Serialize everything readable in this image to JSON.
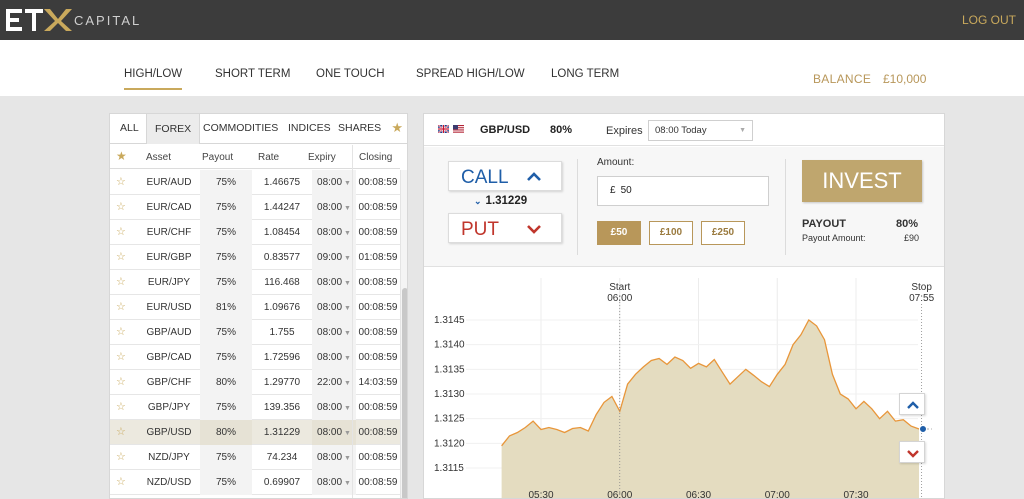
{
  "header": {
    "logo_text": "ETX",
    "logo_word": "CAPITAL",
    "logout_label": "LOG OUT"
  },
  "nav": {
    "items": [
      {
        "label": "HIGH/LOW",
        "active": true
      },
      {
        "label": "SHORT TERM",
        "active": false
      },
      {
        "label": "ONE TOUCH",
        "active": false
      },
      {
        "label": "SPREAD HIGH/LOW",
        "active": false
      },
      {
        "label": "LONG TERM",
        "active": false
      }
    ],
    "balance_label": "BALANCE",
    "balance_value": "£10,000"
  },
  "assets": {
    "filter_tabs": [
      "ALL",
      "FOREX",
      "COMMODITIES",
      "INDICES",
      "SHARES"
    ],
    "active_tab": "FOREX",
    "columns": [
      "Asset",
      "Payout",
      "Rate",
      "Expiry",
      "Closing"
    ],
    "rows": [
      {
        "asset": "EUR/AUD",
        "payout": "75%",
        "rate": "1.46675",
        "expiry": "08:00",
        "closing": "00:08:59"
      },
      {
        "asset": "EUR/CAD",
        "payout": "75%",
        "rate": "1.44247",
        "expiry": "08:00",
        "closing": "00:08:59"
      },
      {
        "asset": "EUR/CHF",
        "payout": "75%",
        "rate": "1.08454",
        "expiry": "08:00",
        "closing": "00:08:59"
      },
      {
        "asset": "EUR/GBP",
        "payout": "75%",
        "rate": "0.83577",
        "expiry": "09:00",
        "closing": "01:08:59"
      },
      {
        "asset": "EUR/JPY",
        "payout": "75%",
        "rate": "116.468",
        "expiry": "08:00",
        "closing": "00:08:59"
      },
      {
        "asset": "EUR/USD",
        "payout": "81%",
        "rate": "1.09676",
        "expiry": "08:00",
        "closing": "00:08:59"
      },
      {
        "asset": "GBP/AUD",
        "payout": "75%",
        "rate": "1.755",
        "expiry": "08:00",
        "closing": "00:08:59"
      },
      {
        "asset": "GBP/CAD",
        "payout": "75%",
        "rate": "1.72596",
        "expiry": "08:00",
        "closing": "00:08:59"
      },
      {
        "asset": "GBP/CHF",
        "payout": "80%",
        "rate": "1.29770",
        "expiry": "22:00",
        "closing": "14:03:59"
      },
      {
        "asset": "GBP/JPY",
        "payout": "75%",
        "rate": "139.356",
        "expiry": "08:00",
        "closing": "00:08:59"
      },
      {
        "asset": "GBP/USD",
        "payout": "80%",
        "rate": "1.31229",
        "expiry": "08:00",
        "closing": "00:08:59",
        "selected": true
      },
      {
        "asset": "NZD/JPY",
        "payout": "75%",
        "rate": "74.234",
        "expiry": "08:00",
        "closing": "00:08:59"
      },
      {
        "asset": "NZD/USD",
        "payout": "75%",
        "rate": "0.69907",
        "expiry": "08:00",
        "closing": "00:08:59"
      }
    ]
  },
  "trade": {
    "pair": "GBP/USD",
    "payout": "80%",
    "expires_label": "Expires",
    "expires_value": "08:00 Today",
    "call_label": "CALL",
    "put_label": "PUT",
    "current_rate": "1.31229",
    "amount_label": "Amount:",
    "currency_symbol": "£",
    "amount_value": "50",
    "quick_amounts": [
      "£50",
      "£100",
      "£250"
    ],
    "active_quick_amount": "£50",
    "invest_label": "INVEST",
    "payout_label": "PAYOUT",
    "payout_pct": "80%",
    "payout_amount_label": "Payout Amount:",
    "payout_amount_value": "£90"
  },
  "colors": {
    "accent_gold": "#c9a95c",
    "call_blue": "#1f5ea8",
    "put_red": "#c0362c",
    "chart_line": "#e8963a",
    "chart_fill": "#e4dcc0"
  },
  "chart_data": {
    "type": "area",
    "y_ticks": [
      "1.3145",
      "1.3140",
      "1.3135",
      "1.3130",
      "1.3125",
      "1.3120",
      "1.3115"
    ],
    "ylim": [
      1.3112,
      1.3148
    ],
    "x_ticks": [
      "05:30",
      "06:00",
      "06:30",
      "07:00",
      "07:30"
    ],
    "start_label": "Start",
    "start_time": "06:00",
    "stop_label": "Stop",
    "stop_time": "07:55",
    "x_minutes": [
      315,
      318,
      321,
      324,
      327,
      330,
      333,
      336,
      339,
      342,
      345,
      348,
      351,
      354,
      357,
      360,
      363,
      366,
      369,
      372,
      375,
      378,
      381,
      384,
      387,
      390,
      393,
      396,
      399,
      402,
      405,
      408,
      411,
      414,
      417,
      420,
      423,
      426,
      429,
      432,
      435,
      438,
      441,
      444,
      447,
      450,
      453,
      456,
      459,
      462,
      465,
      468,
      471,
      474
    ],
    "y_values": [
      1.31195,
      1.31215,
      1.31222,
      1.31232,
      1.31245,
      1.31228,
      1.31232,
      1.31228,
      1.31222,
      1.3123,
      1.31232,
      1.31225,
      1.31258,
      1.31283,
      1.31295,
      1.31265,
      1.3132,
      1.3134,
      1.31355,
      1.31368,
      1.31372,
      1.3136,
      1.31375,
      1.31368,
      1.31352,
      1.31362,
      1.31355,
      1.3137,
      1.31345,
      1.3132,
      1.31335,
      1.3135,
      1.31338,
      1.31325,
      1.31315,
      1.3134,
      1.3136,
      1.314,
      1.3142,
      1.3145,
      1.31438,
      1.3141,
      1.3134,
      1.313,
      1.3129,
      1.3127,
      1.31285,
      1.3127,
      1.3125,
      1.31265,
      1.31245,
      1.31248,
      1.31235,
      1.31229
    ]
  }
}
